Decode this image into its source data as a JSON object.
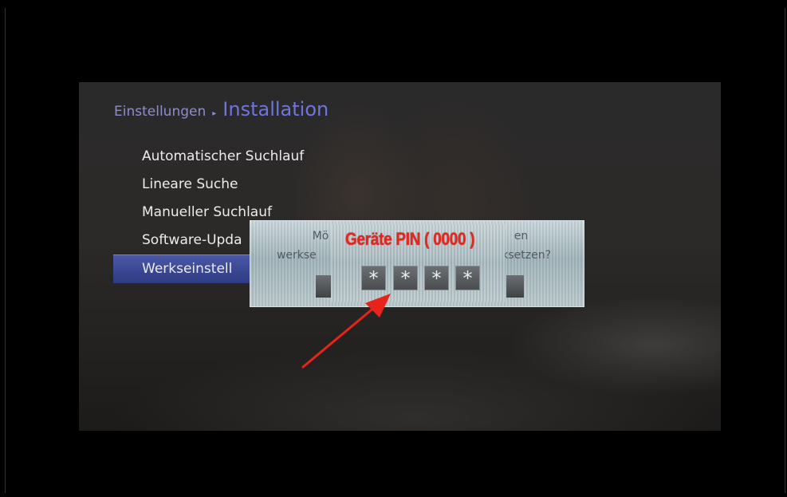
{
  "breadcrumb": {
    "parent": "Einstellungen",
    "current": "Installation"
  },
  "menu": {
    "items": [
      {
        "label": "Automatischer Suchlauf"
      },
      {
        "label": "Lineare Suche"
      },
      {
        "label": "Manueller Suchlauf"
      },
      {
        "label": "Software-Upda"
      },
      {
        "label": "Werkseinstell",
        "selected": true
      }
    ]
  },
  "dialog": {
    "line1_left": "Mö",
    "line1_right": "en",
    "line2_left": "werkse",
    "line2_right": "ksetzen?"
  },
  "pin": {
    "title": "Geräte PIN ( 0000 )",
    "digits": [
      "*",
      "*",
      "*",
      "*"
    ],
    "title_color": "#e7261f"
  },
  "colors": {
    "accent": "#6f74e0",
    "selection": "#3a4690",
    "arrow": "#e8231c"
  },
  "icons": {
    "breadcrumb_separator": "triangle-right-icon",
    "annotation": "red-arrow-icon"
  }
}
